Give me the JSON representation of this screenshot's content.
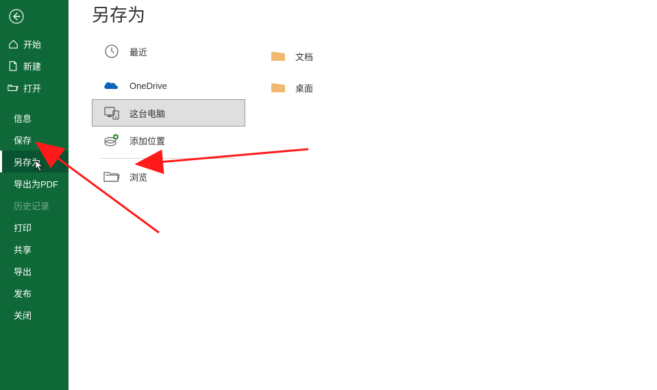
{
  "colors": {
    "sidebar_bg": "#0e6837",
    "accent": "#0e6837",
    "folder": "#f0b971"
  },
  "page": {
    "title": "另存为"
  },
  "sidebar": {
    "items": [
      {
        "label": "开始",
        "icon": "home-icon",
        "hasIcon": true
      },
      {
        "label": "新建",
        "icon": "new-icon",
        "hasIcon": true
      },
      {
        "label": "打开",
        "icon": "open-icon",
        "hasIcon": true
      },
      {
        "label": "信息"
      },
      {
        "label": "保存"
      },
      {
        "label": "另存为",
        "active": true
      },
      {
        "label": "导出为PDF"
      },
      {
        "label": "历史记录",
        "disabled": true
      },
      {
        "label": "打印"
      },
      {
        "label": "共享"
      },
      {
        "label": "导出"
      },
      {
        "label": "发布"
      },
      {
        "label": "关闭"
      }
    ]
  },
  "locations": {
    "items": [
      {
        "label": "最近",
        "icon": "clock-icon"
      },
      {
        "label": "OneDrive",
        "icon": "onedrive-icon"
      },
      {
        "label": "这台电脑",
        "icon": "thispc-icon",
        "selected": true
      },
      {
        "label": "添加位置",
        "icon": "add-location-icon"
      },
      {
        "label": "浏览",
        "icon": "browse-icon"
      }
    ]
  },
  "folders": {
    "items": [
      {
        "label": "文档"
      },
      {
        "label": "桌面"
      }
    ]
  }
}
